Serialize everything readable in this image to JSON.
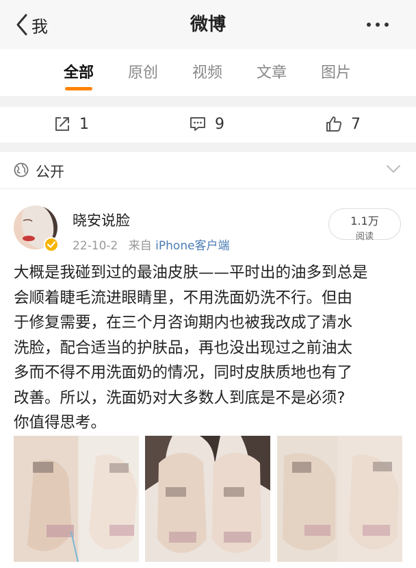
{
  "topbar": {
    "back_label": "我",
    "title": "微博"
  },
  "tabs": [
    {
      "label": "全部",
      "active": true
    },
    {
      "label": "原创",
      "active": false
    },
    {
      "label": "视频",
      "active": false
    },
    {
      "label": "文章",
      "active": false
    },
    {
      "label": "图片",
      "active": false
    }
  ],
  "colors": {
    "accent": "#ff8200",
    "link": "#4a7bb3",
    "verified_badge": "#f7b500"
  },
  "action_bar": {
    "repost": {
      "icon": "share-icon",
      "count": "1"
    },
    "comment": {
      "icon": "comment-icon",
      "count": "9"
    },
    "like": {
      "icon": "thumbs-up-icon",
      "count": "7"
    }
  },
  "visibility": {
    "icon": "globe-icon",
    "label": "公开"
  },
  "post": {
    "username": "晓安说脸",
    "date": "22-10-2",
    "source_prefix": "来自",
    "source": "iPhone客户端",
    "views_count": "1.1万",
    "views_label": "阅读",
    "text_lines": [
      "大概是我碰到过的最油皮肤——平时出的油多到总是",
      "会顺着睫毛流进眼睛里，不用洗面奶洗不行。但由",
      "于修复需要，在三个月咨询期内也被我改成了清水",
      "洗脸，配合适当的护肤品，再也没出现过之前油太",
      "多而不得不用洗面奶的情况，同时皮肤质地也有了",
      "改善。所以，洗面奶对大多数人到底是不是必须?",
      "你值得思考。"
    ],
    "photos": [
      {
        "icon": "photo-thumbnail"
      },
      {
        "icon": "photo-thumbnail"
      },
      {
        "icon": "photo-thumbnail"
      }
    ]
  }
}
